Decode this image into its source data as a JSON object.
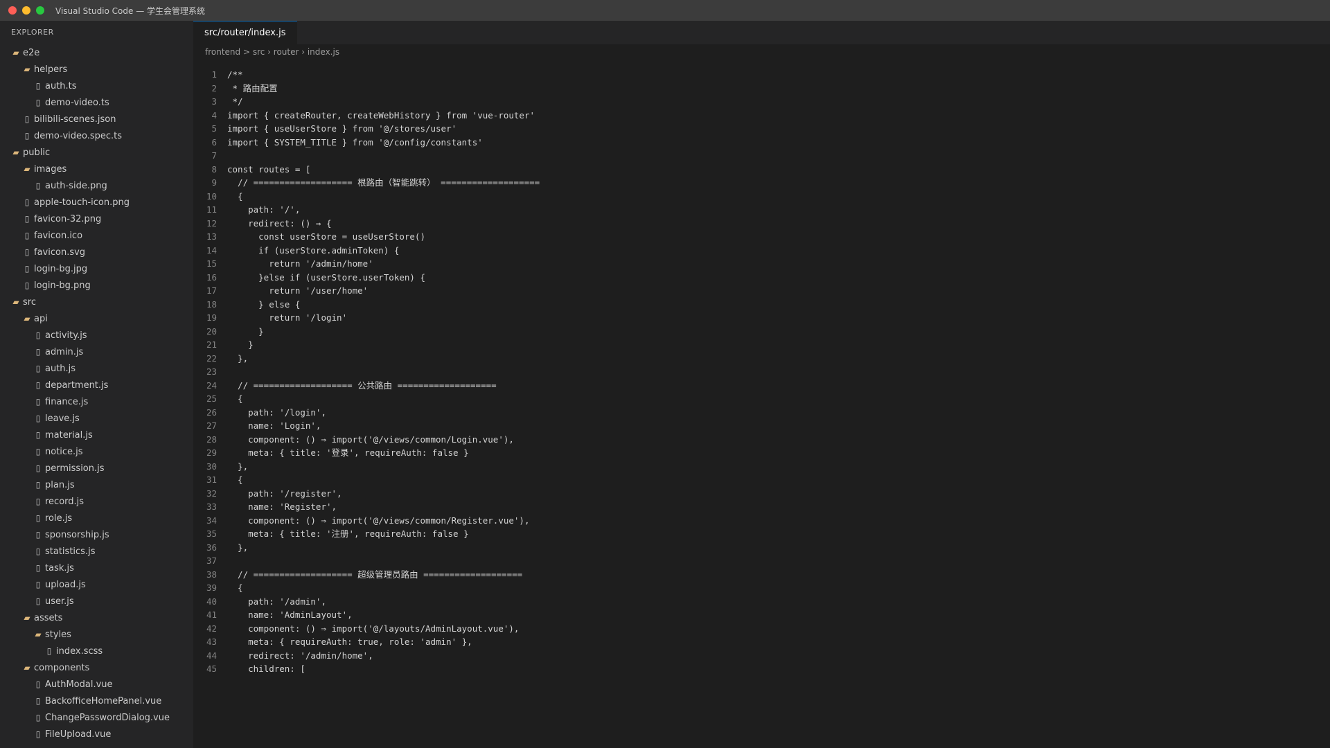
{
  "window": {
    "title": "Visual Studio Code — 学生会管理系统"
  },
  "explorer": {
    "header": "EXPLORER",
    "items": [
      {
        "label": "e2e",
        "type": "folder",
        "depth": 0
      },
      {
        "label": "helpers",
        "type": "folder",
        "depth": 1
      },
      {
        "label": "auth.ts",
        "type": "file",
        "depth": 2
      },
      {
        "label": "demo-video.ts",
        "type": "file",
        "depth": 2
      },
      {
        "label": "bilibili-scenes.json",
        "type": "file",
        "depth": 1
      },
      {
        "label": "demo-video.spec.ts",
        "type": "file",
        "depth": 1
      },
      {
        "label": "public",
        "type": "folder",
        "depth": 0
      },
      {
        "label": "images",
        "type": "folder",
        "depth": 1
      },
      {
        "label": "auth-side.png",
        "type": "file",
        "depth": 2
      },
      {
        "label": "apple-touch-icon.png",
        "type": "file",
        "depth": 1
      },
      {
        "label": "favicon-32.png",
        "type": "file",
        "depth": 1
      },
      {
        "label": "favicon.ico",
        "type": "file",
        "depth": 1
      },
      {
        "label": "favicon.svg",
        "type": "file",
        "depth": 1
      },
      {
        "label": "login-bg.jpg",
        "type": "file",
        "depth": 1
      },
      {
        "label": "login-bg.png",
        "type": "file",
        "depth": 1
      },
      {
        "label": "src",
        "type": "folder",
        "depth": 0
      },
      {
        "label": "api",
        "type": "folder",
        "depth": 1
      },
      {
        "label": "activity.js",
        "type": "file",
        "depth": 2
      },
      {
        "label": "admin.js",
        "type": "file",
        "depth": 2
      },
      {
        "label": "auth.js",
        "type": "file",
        "depth": 2
      },
      {
        "label": "department.js",
        "type": "file",
        "depth": 2
      },
      {
        "label": "finance.js",
        "type": "file",
        "depth": 2
      },
      {
        "label": "leave.js",
        "type": "file",
        "depth": 2
      },
      {
        "label": "material.js",
        "type": "file",
        "depth": 2
      },
      {
        "label": "notice.js",
        "type": "file",
        "depth": 2
      },
      {
        "label": "permission.js",
        "type": "file",
        "depth": 2
      },
      {
        "label": "plan.js",
        "type": "file",
        "depth": 2
      },
      {
        "label": "record.js",
        "type": "file",
        "depth": 2
      },
      {
        "label": "role.js",
        "type": "file",
        "depth": 2
      },
      {
        "label": "sponsorship.js",
        "type": "file",
        "depth": 2
      },
      {
        "label": "statistics.js",
        "type": "file",
        "depth": 2
      },
      {
        "label": "task.js",
        "type": "file",
        "depth": 2
      },
      {
        "label": "upload.js",
        "type": "file",
        "depth": 2
      },
      {
        "label": "user.js",
        "type": "file",
        "depth": 2
      },
      {
        "label": "assets",
        "type": "folder",
        "depth": 1
      },
      {
        "label": "styles",
        "type": "folder",
        "depth": 2
      },
      {
        "label": "index.scss",
        "type": "file",
        "depth": 3
      },
      {
        "label": "components",
        "type": "folder",
        "depth": 1
      },
      {
        "label": "AuthModal.vue",
        "type": "file",
        "depth": 2
      },
      {
        "label": "BackofficeHomePanel.vue",
        "type": "file",
        "depth": 2
      },
      {
        "label": "ChangePasswordDialog.vue",
        "type": "file",
        "depth": 2
      },
      {
        "label": "FileUpload.vue",
        "type": "file",
        "depth": 2
      }
    ]
  },
  "editor": {
    "active_tab": "src/router/index.js",
    "breadcrumb": "frontend > src › router › index.js",
    "lines": [
      "/**",
      " * 路由配置",
      " */",
      "import { createRouter, createWebHistory } from 'vue-router'",
      "import { useUserStore } from '@/stores/user'",
      "import { SYSTEM_TITLE } from '@/config/constants'",
      "",
      "const routes = [",
      "  // =================== 根路由（智能跳转） ===================",
      "  {",
      "    path: '/',",
      "    redirect: () ⇒ {",
      "      const userStore = useUserStore()",
      "      if (userStore.adminToken) {",
      "        return '/admin/home'",
      "      }else if (userStore.userToken) {",
      "        return '/user/home'",
      "      } else {",
      "        return '/login'",
      "      }",
      "    }",
      "  },",
      "",
      "  // =================== 公共路由 ===================",
      "  {",
      "    path: '/login',",
      "    name: 'Login',",
      "    component: () ⇒ import('@/views/common/Login.vue'),",
      "    meta: { title: '登录', requireAuth: false }",
      "  },",
      "  {",
      "    path: '/register',",
      "    name: 'Register',",
      "    component: () ⇒ import('@/views/common/Register.vue'),",
      "    meta: { title: '注册', requireAuth: false }",
      "  },",
      "",
      "  // =================== 超级管理员路由 ===================",
      "  {",
      "    path: '/admin',",
      "    name: 'AdminLayout',",
      "    component: () ⇒ import('@/layouts/AdminLayout.vue'),",
      "    meta: { requireAuth: true, role: 'admin' },",
      "    redirect: '/admin/home',",
      "    children: ["
    ]
  },
  "colors": {
    "titlebar": "#3c3c3c",
    "sidebar": "#252526",
    "editor": "#1e1e1e",
    "folder_icon": "#dcb67a"
  }
}
